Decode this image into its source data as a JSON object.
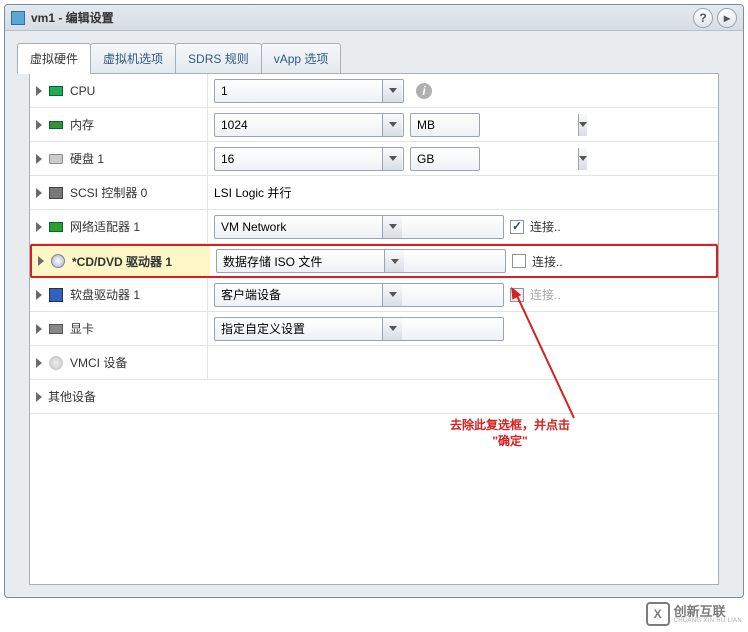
{
  "title": "vm1 - 编辑设置",
  "tabs": [
    "虚拟硬件",
    "虚拟机选项",
    "SDRS 规则",
    "vApp 选项"
  ],
  "active_tab": 0,
  "rows": {
    "cpu": {
      "label": "CPU",
      "value": "1"
    },
    "mem": {
      "label": "内存",
      "value": "1024",
      "unit": "MB"
    },
    "disk": {
      "label": "硬盘 1",
      "value": "16",
      "unit": "GB"
    },
    "scsi": {
      "label": "SCSI 控制器 0",
      "value": "LSI Logic 并行"
    },
    "net": {
      "label": "网络适配器 1",
      "value": "VM Network",
      "connect": "连接..",
      "checked": true
    },
    "cd": {
      "label": "*CD/DVD 驱动器 1",
      "value": "数据存储 ISO 文件",
      "connect": "连接..",
      "checked": false
    },
    "floppy": {
      "label": "软盘驱动器 1",
      "value": "客户端设备",
      "connect": "连接..",
      "disabled": true
    },
    "gpu": {
      "label": "显卡",
      "value": "指定自定义设置"
    },
    "vmci": {
      "label": "VMCI 设备"
    },
    "other": {
      "label": "其他设备"
    }
  },
  "annotation": {
    "line1": "去除此复选框，并点击",
    "line2": "\"确定\""
  },
  "watermark": {
    "logo_letter": "X",
    "brand": "创新互联",
    "sub": "CHUANG XIN HU LIAN"
  }
}
